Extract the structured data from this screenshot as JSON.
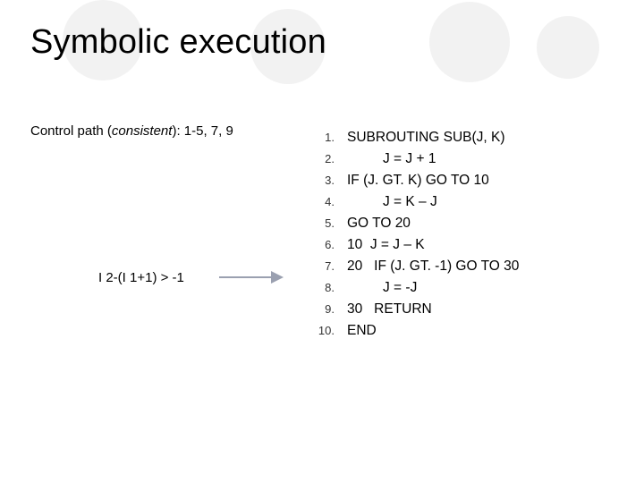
{
  "title": "Symbolic execution",
  "control_path": {
    "prefix": "Control path ",
    "status": "consistent",
    "tail": ": 1-5, 7, 9"
  },
  "formula": "I 2-(I 1+1) > -1",
  "code": [
    {
      "n": "1.",
      "text": "SUBROUTING SUB(J, K)"
    },
    {
      "n": "2.",
      "text": "J = J + 1"
    },
    {
      "n": "3.",
      "text": "IF (J. GT. K) GO TO 10"
    },
    {
      "n": "4.",
      "text": "J = K – J"
    },
    {
      "n": "5.",
      "text": "GO TO 20"
    },
    {
      "n": "6.",
      "text": "10  J = J – K"
    },
    {
      "n": "7.",
      "text": "20   IF (J. GT. -1) GO TO 30"
    },
    {
      "n": "8.",
      "text": "J = -J"
    },
    {
      "n": "9.",
      "text": "30   RETURN"
    },
    {
      "n": "10.",
      "text": "END"
    }
  ]
}
